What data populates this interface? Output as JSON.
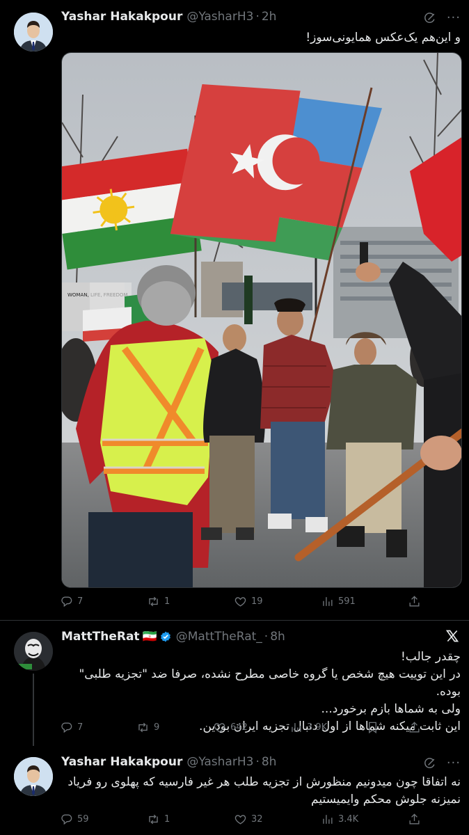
{
  "tweet1": {
    "name": "Yashar Hakakpour",
    "handle": "@YasharH3",
    "time": "2h",
    "text": "و این‌هم یک‌عکس همایونی‌سوز!",
    "sign_text": "WOMAN, LIFE, FREEDOM",
    "stats": {
      "replies": "7",
      "retweets": "1",
      "likes": "19",
      "views": "591"
    }
  },
  "tweet2": {
    "name": "MattTheRat",
    "flag": "🇮🇷",
    "handle": "@MattTheRat_",
    "time": "8h",
    "lines": [
      "چقدر جالب!",
      "در این توییت هیچ شخص یا گروه خاصی مطرح نشده، صرفا ضد \"تجزیه طلبی\" بوده.",
      "ولی به شماها بازم برخورد...",
      "این ثابت میکنه شماها از اول دنبال تجزیه ایران بودین."
    ],
    "stats": {
      "replies": "7",
      "retweets": "9",
      "likes": "642",
      "views": "3.9K"
    }
  },
  "tweet3": {
    "name": "Yashar Hakakpour",
    "handle": "@YasharH3",
    "time": "8h",
    "lines": [
      "نه اتفاقا چون میدونیم منظورش از تجزیه طلب هر غیر فارسیه که پهلوی رو فریاد",
      "نمیزنه جلوش محکم وایمیستیم"
    ],
    "stats": {
      "replies": "59",
      "retweets": "1",
      "likes": "32",
      "views": "3.4K"
    }
  },
  "icons": {
    "reply": "reply-icon",
    "retweet": "retweet-icon",
    "like": "heart-icon",
    "views": "views-icon",
    "bookmark": "bookmark-icon",
    "share": "share-icon",
    "grok": "grok-icon",
    "more": "more-icon",
    "x_logo": "x-logo-icon",
    "verified": "verified-badge-icon"
  },
  "colors": {
    "background": "#000000",
    "text": "#e7e9ea",
    "muted": "#71767b",
    "verified": "#1d9bf0",
    "divider": "#2f3336"
  }
}
